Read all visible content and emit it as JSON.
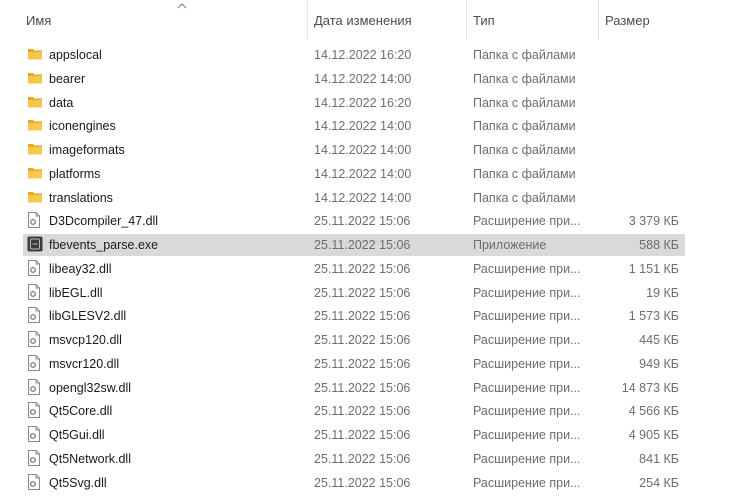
{
  "columns": {
    "name": "Имя",
    "date": "Дата изменения",
    "type": "Тип",
    "size": "Размер"
  },
  "files": [
    {
      "name": "appslocal",
      "date": "14.12.2022 16:20",
      "type": "Папка с файлами",
      "size": "",
      "icon": "folder"
    },
    {
      "name": "bearer",
      "date": "14.12.2022 14:00",
      "type": "Папка с файлами",
      "size": "",
      "icon": "folder"
    },
    {
      "name": "data",
      "date": "14.12.2022 16:20",
      "type": "Папка с файлами",
      "size": "",
      "icon": "folder"
    },
    {
      "name": "iconengines",
      "date": "14.12.2022 14:00",
      "type": "Папка с файлами",
      "size": "",
      "icon": "folder"
    },
    {
      "name": "imageformats",
      "date": "14.12.2022 14:00",
      "type": "Папка с файлами",
      "size": "",
      "icon": "folder"
    },
    {
      "name": "platforms",
      "date": "14.12.2022 14:00",
      "type": "Папка с файлами",
      "size": "",
      "icon": "folder"
    },
    {
      "name": "translations",
      "date": "14.12.2022 14:00",
      "type": "Папка с файлами",
      "size": "",
      "icon": "folder"
    },
    {
      "name": "D3Dcompiler_47.dll",
      "date": "25.11.2022 15:06",
      "type": "Расширение при...",
      "size": "3 379 КБ",
      "icon": "dll"
    },
    {
      "name": "fbevents_parse.exe",
      "date": "25.11.2022 15:06",
      "type": "Приложение",
      "size": "588 КБ",
      "icon": "exe",
      "selected": true
    },
    {
      "name": "libeay32.dll",
      "date": "25.11.2022 15:06",
      "type": "Расширение при...",
      "size": "1 151 КБ",
      "icon": "dll"
    },
    {
      "name": "libEGL.dll",
      "date": "25.11.2022 15:06",
      "type": "Расширение при...",
      "size": "19 КБ",
      "icon": "dll"
    },
    {
      "name": "libGLESV2.dll",
      "date": "25.11.2022 15:06",
      "type": "Расширение при...",
      "size": "1 573 КБ",
      "icon": "dll"
    },
    {
      "name": "msvcp120.dll",
      "date": "25.11.2022 15:06",
      "type": "Расширение при...",
      "size": "445 КБ",
      "icon": "dll"
    },
    {
      "name": "msvcr120.dll",
      "date": "25.11.2022 15:06",
      "type": "Расширение при...",
      "size": "949 КБ",
      "icon": "dll"
    },
    {
      "name": "opengl32sw.dll",
      "date": "25.11.2022 15:06",
      "type": "Расширение при...",
      "size": "14 873 КБ",
      "icon": "dll"
    },
    {
      "name": "Qt5Core.dll",
      "date": "25.11.2022 15:06",
      "type": "Расширение при...",
      "size": "4 566 КБ",
      "icon": "dll"
    },
    {
      "name": "Qt5Gui.dll",
      "date": "25.11.2022 15:06",
      "type": "Расширение при...",
      "size": "4 905 КБ",
      "icon": "dll"
    },
    {
      "name": "Qt5Network.dll",
      "date": "25.11.2022 15:06",
      "type": "Расширение при...",
      "size": "841 КБ",
      "icon": "dll"
    },
    {
      "name": "Qt5Svg.dll",
      "date": "25.11.2022 15:06",
      "type": "Расширение при...",
      "size": "254 КБ",
      "icon": "dll"
    }
  ],
  "colors": {
    "folder": "#f8c74a",
    "selection": "#d9d9d9"
  }
}
